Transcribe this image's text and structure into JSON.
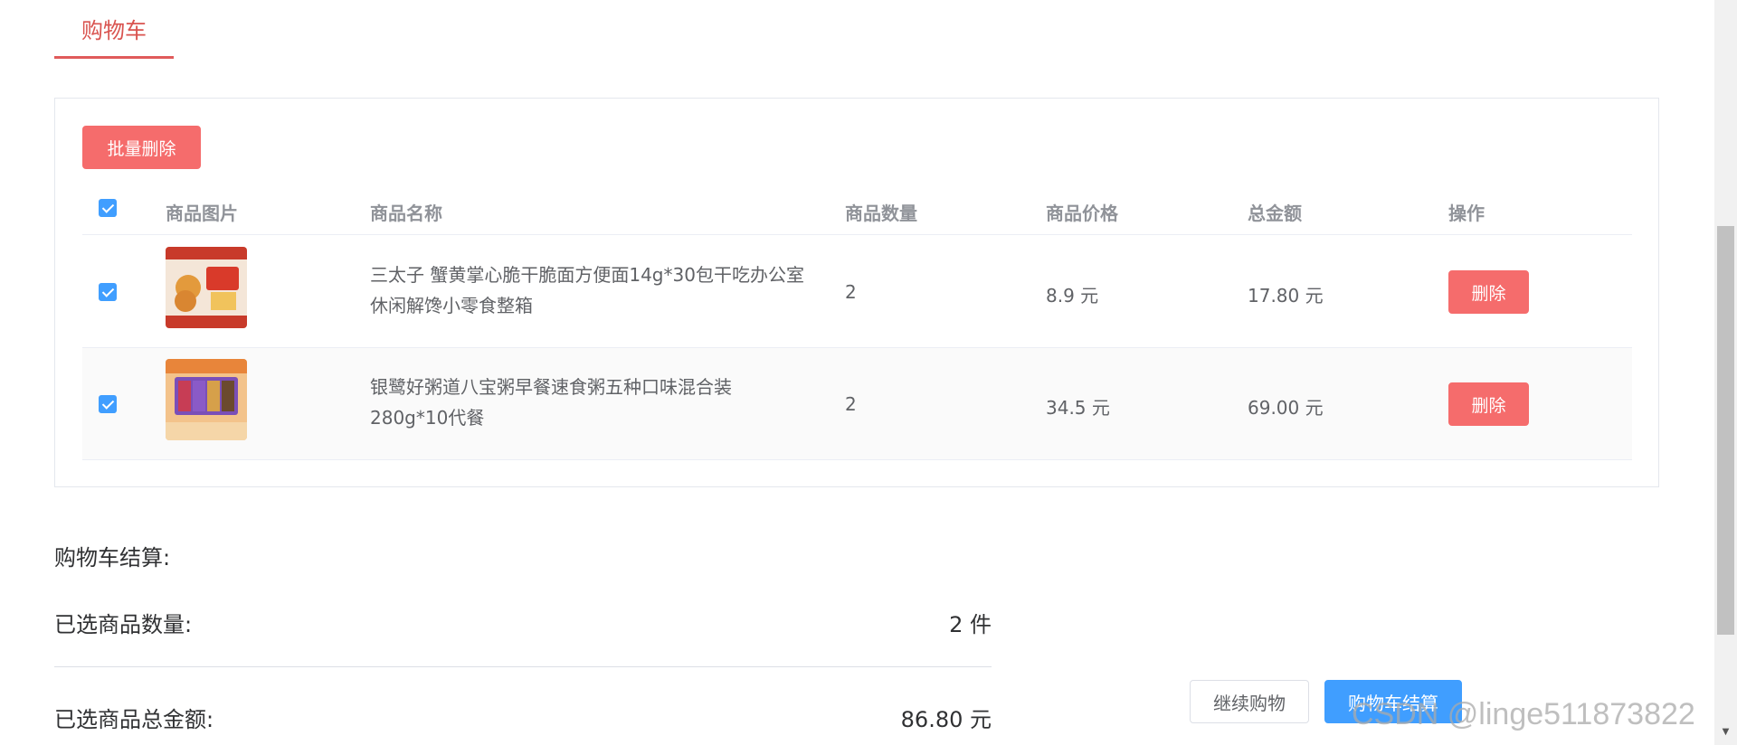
{
  "tab": {
    "title": "购物车"
  },
  "toolbar": {
    "batch_delete_label": "批量删除"
  },
  "table": {
    "headers": {
      "image": "商品图片",
      "name": "商品名称",
      "quantity": "商品数量",
      "price": "商品价格",
      "total": "总金额",
      "action": "操作"
    },
    "rows": [
      {
        "checked": true,
        "image_icon": "instant-noodle-snack-thumbnail",
        "name": "三太子 蟹黄掌心脆干脆面方便面14g*30包干吃办公室休闲解馋小零食整箱",
        "quantity": "2",
        "price": "8.9 元",
        "total": "17.80 元",
        "action_label": "删除"
      },
      {
        "checked": true,
        "image_icon": "congee-pack-thumbnail",
        "name": "银鹭好粥道八宝粥早餐速食粥五种口味混合装280g*10代餐",
        "quantity": "2",
        "price": "34.5 元",
        "total": "69.00 元",
        "action_label": "删除"
      }
    ]
  },
  "summary": {
    "title": "购物车结算:",
    "count_label": "已选商品数量:",
    "count_value": "2 件",
    "amount_label": "已选商品总金额:",
    "amount_value": "86.80 元"
  },
  "actions": {
    "continue_label": "继续购物",
    "checkout_label": "购物车结算"
  },
  "watermark": "CSDN @linge511873822",
  "colors": {
    "danger": "#f56c6c",
    "primary": "#409eff",
    "tab_accent": "#d9534f"
  }
}
